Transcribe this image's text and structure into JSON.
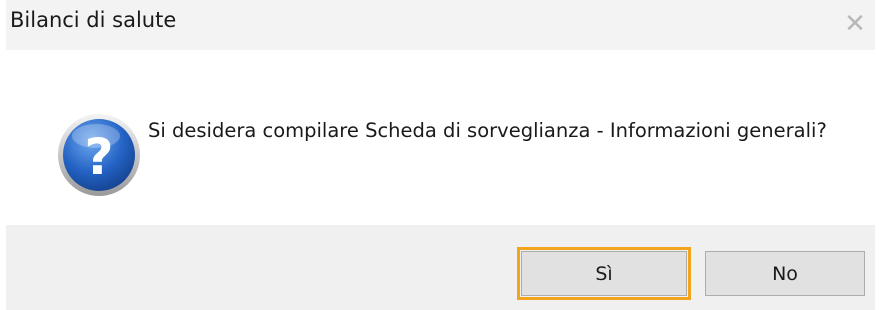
{
  "window": {
    "title": "Bilanci di salute",
    "close_glyph": "✕"
  },
  "dialog": {
    "icon": "question-icon",
    "message": "Si desidera compilare Scheda di sorveglianza - Informazioni generali?"
  },
  "buttons": {
    "yes_label": "Sì",
    "no_label": "No"
  },
  "colors": {
    "highlight": "#f2a51c",
    "icon_blue": "#1f5fb8"
  }
}
